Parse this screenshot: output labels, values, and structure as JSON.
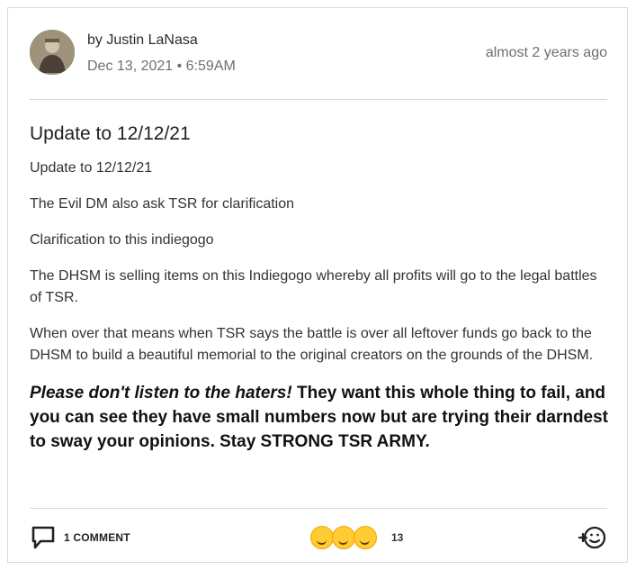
{
  "post": {
    "author": "by Justin LaNasa",
    "date": "Dec 13, 2021 • 6:59AM",
    "relative_time": "almost 2 years ago",
    "title": "Update to 12/12/21",
    "paragraphs": [
      "Update to 12/12/21",
      "The Evil DM also ask TSR for clarification",
      "Clarification to this indiegogo",
      "The DHSM is selling items on this Indiegogo whereby all profits will go to the legal battles of TSR.",
      "When over that means when TSR says the battle is over all leftover funds go back to the DHSM to build a beautiful memorial to the original creators on the grounds of the DHSM."
    ],
    "emphasis": {
      "italic": "Please don't listen to the haters!",
      "rest": " They want this whole thing to fail, and you can see they have small numbers now but are trying their darndest to sway your opinions.  Stay STRONG TSR ARMY."
    }
  },
  "footer": {
    "comment_label": "1 COMMENT",
    "reaction_count": "13",
    "reaction_icons": [
      "laughing-emoji-icon",
      "smiling-emoji-icon",
      "thinking-emoji-icon"
    ],
    "add_reaction_icon": "add-reaction-icon"
  },
  "colors": {
    "text": "#333333",
    "muted": "#6f6f6f",
    "divider": "#d7d7d7",
    "emoji": "#ffcc33"
  }
}
